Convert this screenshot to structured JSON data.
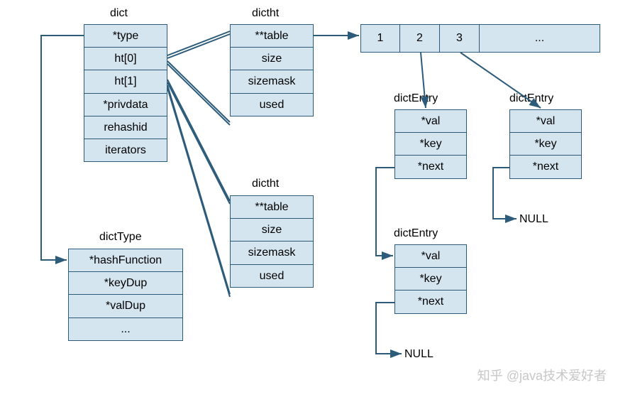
{
  "dict": {
    "title": "dict",
    "fields": [
      "*type",
      "ht[0]",
      "ht[1]",
      "*privdata",
      "rehashid",
      "iterators"
    ]
  },
  "dictType": {
    "title": "dictType",
    "fields": [
      "*hashFunction",
      "*keyDup",
      "*valDup",
      "..."
    ]
  },
  "dictht1": {
    "title": "dictht",
    "fields": [
      "**table",
      "size",
      "sizemask",
      "used"
    ]
  },
  "dictht2": {
    "title": "dictht",
    "fields": [
      "**table",
      "size",
      "sizemask",
      "used"
    ]
  },
  "tableArray": {
    "cells": [
      "1",
      "2",
      "3",
      "..."
    ]
  },
  "entry1": {
    "title": "dictEntry",
    "fields": [
      "*val",
      "*key",
      "*next"
    ]
  },
  "entry2": {
    "title": "dictEntry",
    "fields": [
      "*val",
      "*key",
      "*next"
    ]
  },
  "entry1b": {
    "title": "dictEntry",
    "fields": [
      "*val",
      "*key",
      "*next"
    ]
  },
  "null1": "NULL",
  "null2": "NULL",
  "watermark": "知乎 @java技术爱好者"
}
